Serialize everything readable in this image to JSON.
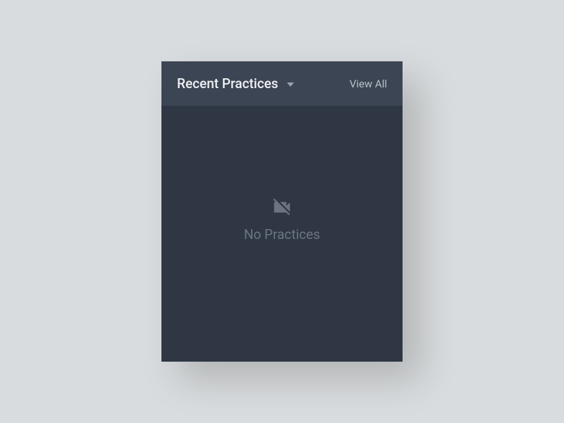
{
  "header": {
    "title": "Recent Practices",
    "view_all_label": "View All"
  },
  "empty_state": {
    "message": "No Practices"
  }
}
